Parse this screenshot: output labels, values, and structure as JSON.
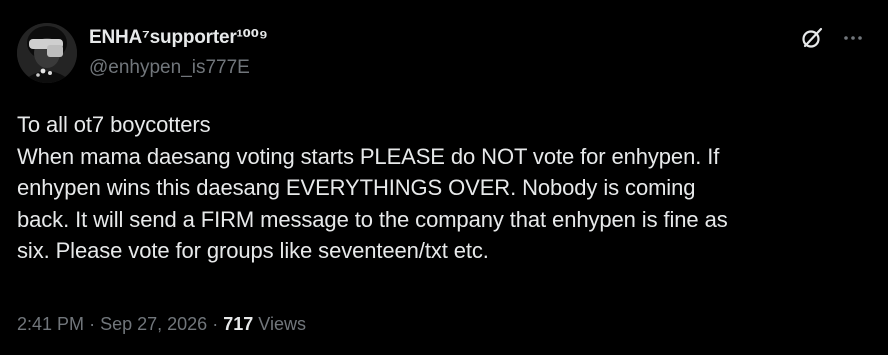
{
  "tweet": {
    "author": {
      "display_name": "ENHA⁷supporter¹⁰⁰⁹",
      "handle": "@enhypen_is777E"
    },
    "text_lines": [
      "To all ot7 boycotters",
      "When mama daesang voting starts PLEASE do NOT vote for enhypen. If",
      "enhypen wins this daesang EVERYTHINGS OVER. Nobody is coming",
      "back. It will send a FIRM message to the company that enhypen is fine as",
      "six. Please vote for groups like seventeen/txt etc."
    ],
    "time": "2:41 PM",
    "separator": "·",
    "date": "Sep 27, 2026",
    "views_count": "717",
    "views_label": "Views"
  },
  "icons": {
    "grok": "grok-icon",
    "more": "more-icon"
  },
  "colors": {
    "background": "#000000",
    "primary_text": "#e7e9ea",
    "secondary_text": "#71767b"
  }
}
